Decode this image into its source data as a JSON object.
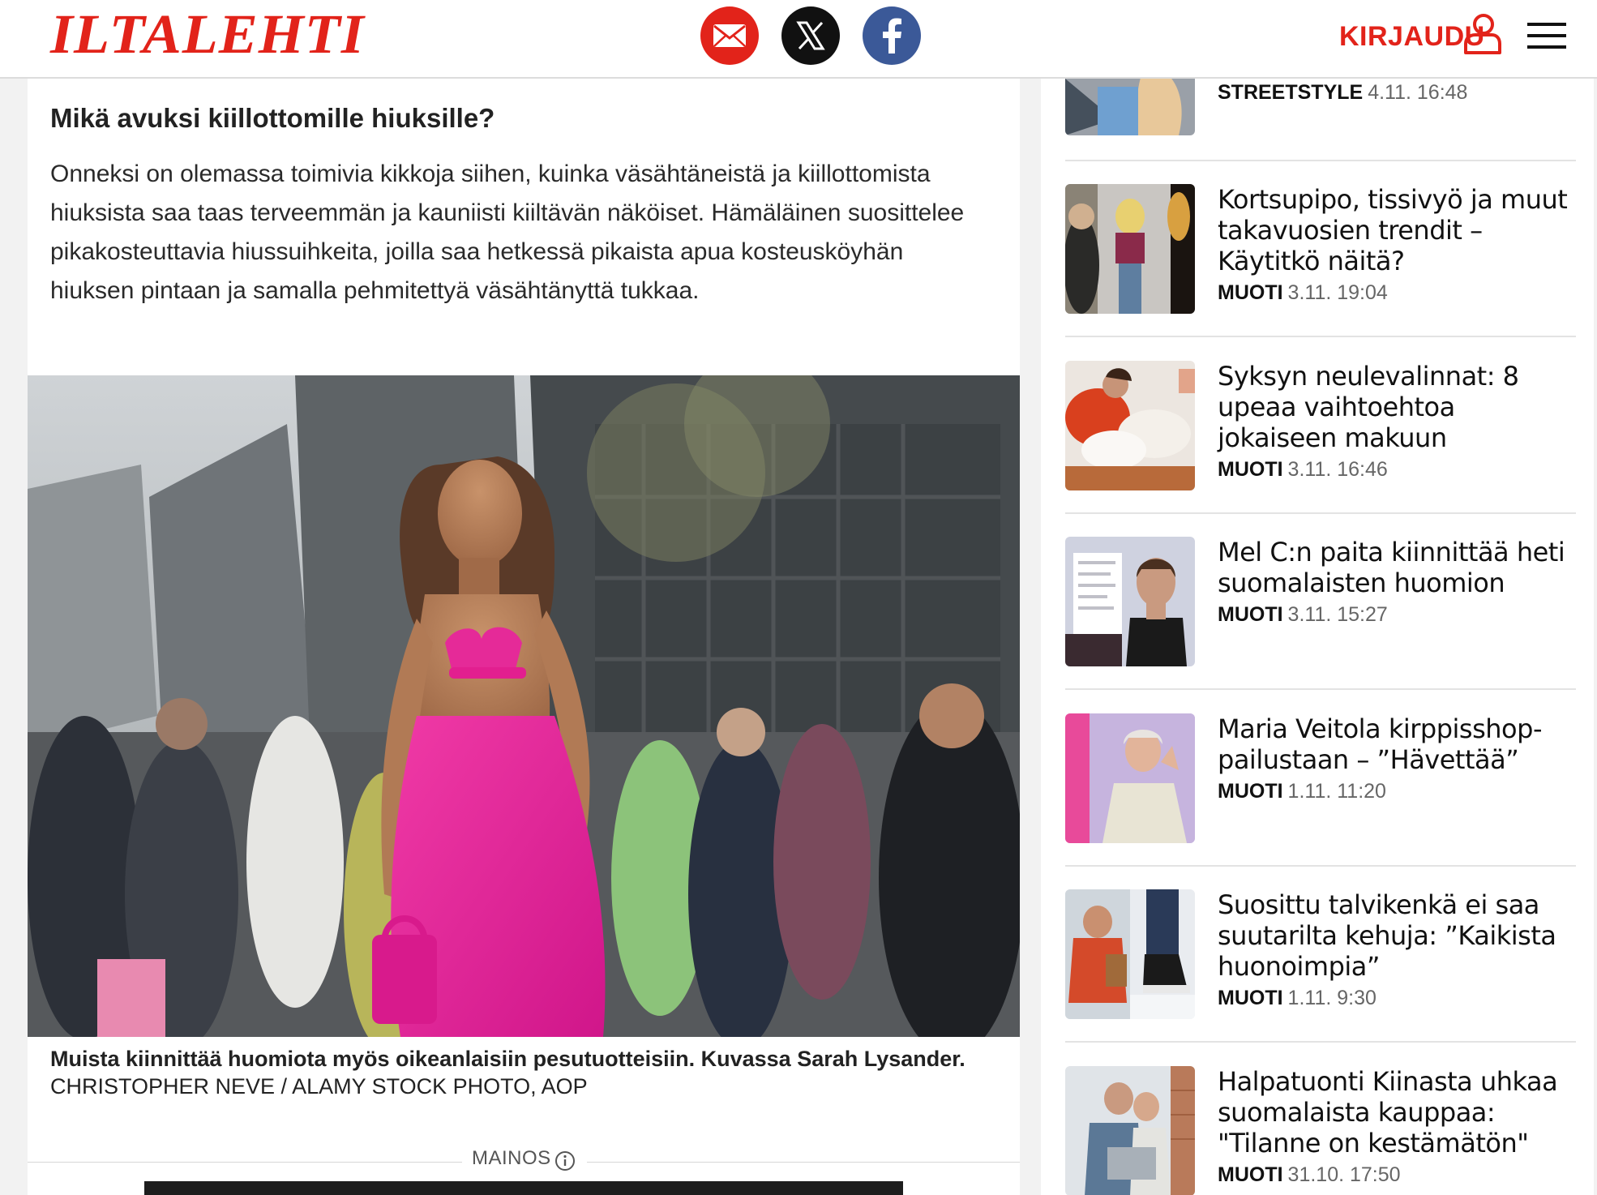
{
  "header": {
    "logo": "ILTALEHTI",
    "share": {
      "mail": "mail-icon",
      "x": "x-icon",
      "facebook": "facebook-icon"
    },
    "login_label": "KIRJAUDU",
    "colors": {
      "brand": "#e2231a",
      "facebook": "#3b5998",
      "x": "#111111"
    }
  },
  "article": {
    "subheading": "Mikä avuksi kiillottomille hiuksille?",
    "paragraph": "Onneksi on olemassa toimivia kikkoja siihen, kuinka väsähtäneistä ja kiillottomista hiuksista saa taas terveemmän ja kauniisti kiiltävän näköiset. Hämäläinen suosittelee pikakosteuttavia hiussuihkeita, joilla saa hetkessä pikaista apua kosteusköyhän hiuksen pintaan ja samalla pehmitettyä väsähtänyttä tukkaa.",
    "caption": "Muista kiinnittää huomiota myös oikeanlaisiin pesutuotteisiin. Kuvassa Sarah Lysander.",
    "credit": "CHRISTOPHER NEVE / ALAMY STOCK PHOTO, AOP",
    "ad_label": "MAINOS"
  },
  "sidebar": {
    "items": [
      {
        "title": "",
        "category": "STREETSTYLE",
        "time": "4.11. 16:48"
      },
      {
        "title": "Kortsupipo, tissivyö ja muut takavuosien trendit – Käytitkö näitä?",
        "category": "MUOTI",
        "time": "3.11. 19:04"
      },
      {
        "title": "Syksyn neulevalinnat: 8 upeaa vaihtoehtoa jokaiseen makuun",
        "category": "MUOTI",
        "time": "3.11. 16:46"
      },
      {
        "title": "Mel C:n paita kiinnittää heti suomalaisten huomion",
        "category": "MUOTI",
        "time": "3.11. 15:27"
      },
      {
        "title": "Maria Veitola kirppisshop-pailustaan – ”Hävettää”",
        "category": "MUOTI",
        "time": "1.11. 11:20"
      },
      {
        "title": "Suosittu talvikenkä ei saa suutarilta kehuja: ”Kaikista huonoimpia”",
        "category": "MUOTI",
        "time": "1.11. 9:30"
      },
      {
        "title": "Halpatuonti Kiinasta uhkaa suomalaista kauppaa: \"Tilanne on kestämätön\"",
        "category": "MUOTI",
        "time": "31.10. 17:50"
      }
    ]
  }
}
